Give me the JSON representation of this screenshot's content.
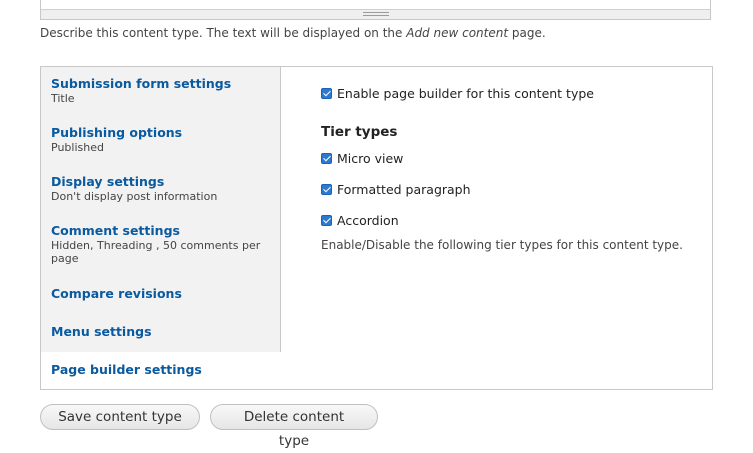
{
  "description": {
    "before": "Describe this content type. The text will be displayed on the ",
    "emphasis": "Add new content",
    "after": " page."
  },
  "tabs": [
    {
      "title": "Submission form settings",
      "summary": "Title"
    },
    {
      "title": "Publishing options",
      "summary": "Published"
    },
    {
      "title": "Display settings",
      "summary": "Don't display post information"
    },
    {
      "title": "Comment settings",
      "summary": "Hidden, Threading , 50 comments per page"
    },
    {
      "title": "Compare revisions",
      "summary": ""
    },
    {
      "title": "Menu settings",
      "summary": ""
    },
    {
      "title": "Page builder settings",
      "summary": ""
    }
  ],
  "panel": {
    "enable_label": "Enable page builder for this content type",
    "enable_checked": true,
    "tier_heading": "Tier types",
    "tiers": [
      {
        "label": "Micro view",
        "checked": true
      },
      {
        "label": "Formatted paragraph",
        "checked": true
      },
      {
        "label": "Accordion",
        "checked": true
      }
    ],
    "description": "Enable/Disable the following tier types for this content type."
  },
  "actions": {
    "save_label": "Save content type",
    "delete_label": "Delete content type"
  },
  "colors": {
    "link": "#0a5aa0",
    "checkbox": "#2c79d0",
    "tab_bg": "#f2f2f2"
  }
}
